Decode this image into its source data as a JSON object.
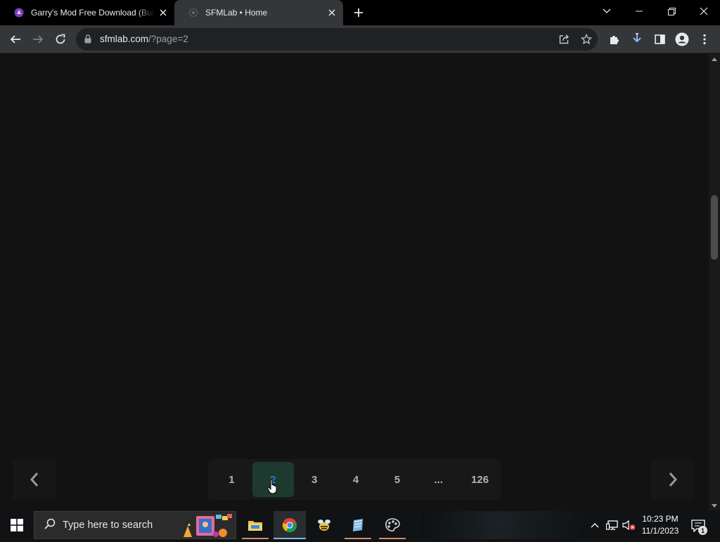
{
  "browser": {
    "tabs": [
      {
        "title": "Garry's Mod Free Download (Bui",
        "active": false
      },
      {
        "title": "SFMLab • Home",
        "active": true
      }
    ],
    "address": {
      "host": "sfmlab.com",
      "path": "/?page=2"
    }
  },
  "page": {
    "pagination": {
      "pages": [
        "1",
        "2",
        "3",
        "4",
        "5",
        "...",
        "126"
      ],
      "current": "2"
    }
  },
  "taskbar": {
    "search_placeholder": "Type here to search",
    "time": "10:23 PM",
    "date": "11/1/2023",
    "notification_count": "1"
  },
  "colors": {
    "page_bg": "#121212",
    "active_page_bg": "#1e3a2f",
    "active_page_text": "#2a78d6",
    "tab_active_bg": "#35363a"
  }
}
